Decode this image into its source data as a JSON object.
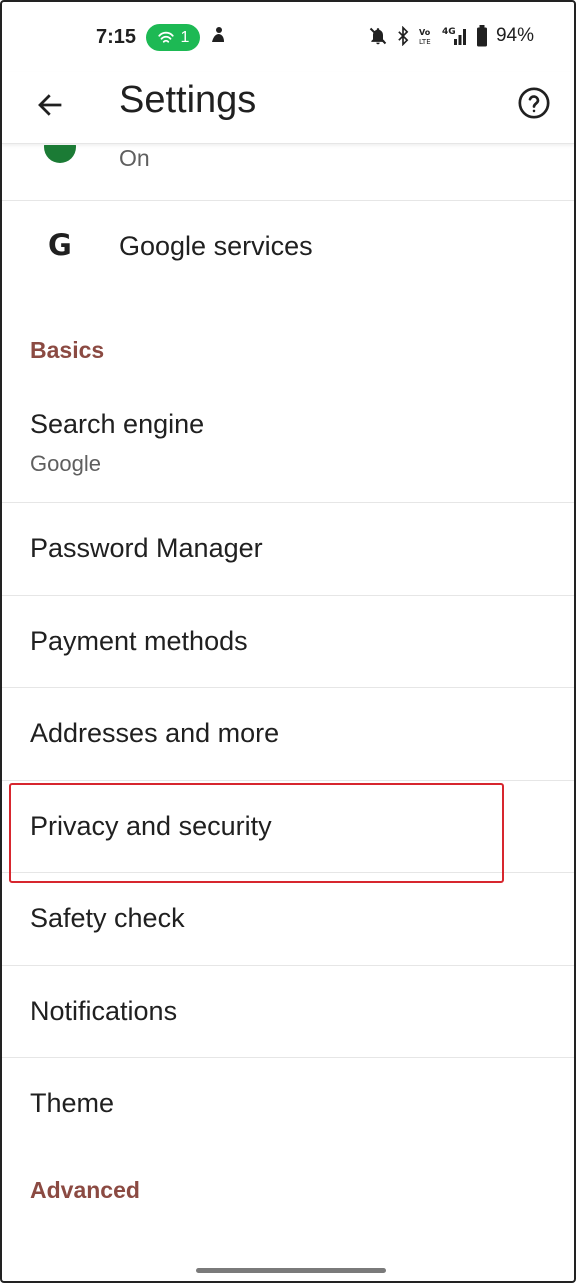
{
  "status_bar": {
    "time": "7:15",
    "hotspot_count": "1",
    "battery_percent": "94%",
    "icons": [
      "hotspot-icon",
      "notification-app-icon",
      "mute-icon",
      "bluetooth-icon",
      "volte-icon",
      "signal-4g-icon",
      "battery-icon"
    ]
  },
  "app_bar": {
    "title": "Settings",
    "back_icon": "arrow-back-icon",
    "help_icon": "help-circle-icon"
  },
  "list": {
    "partial_item_subtitle": "On",
    "google_services_label": "Google services",
    "basics_header": "Basics",
    "search_engine": {
      "label": "Search engine",
      "value": "Google"
    },
    "items": [
      "Password Manager",
      "Payment methods",
      "Addresses and more",
      "Privacy and security",
      "Safety check",
      "Notifications",
      "Theme"
    ],
    "advanced_header": "Advanced"
  },
  "colors": {
    "section_header": "#8b4a42",
    "highlight_box": "#d7262e",
    "hotspot_pill": "#1db954"
  }
}
